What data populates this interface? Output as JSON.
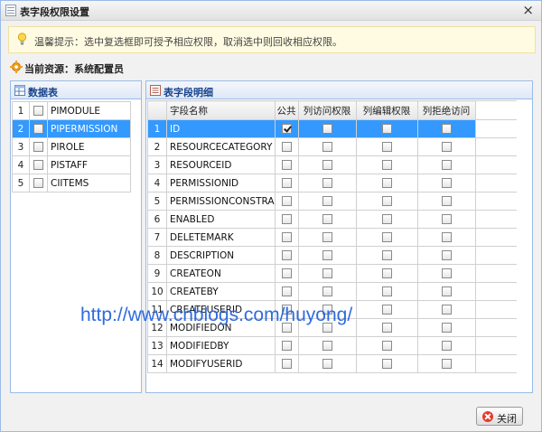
{
  "window": {
    "title": "表字段权限设置",
    "close_glyph": "×"
  },
  "tip": {
    "icon": "lightbulb-icon",
    "text": "温馨提示：选中复选框即可授予相应权限，取消选中则回收相应权限。"
  },
  "resource": {
    "icon": "gear-icon",
    "text": "当前资源：系统配置员"
  },
  "left_panel": {
    "title": "数据表",
    "icon": "table-icon",
    "rows": [
      {
        "num": "1",
        "name": "PIMODULE",
        "checked": false,
        "selected": false
      },
      {
        "num": "2",
        "name": "PIPERMISSION",
        "checked": false,
        "selected": true
      },
      {
        "num": "3",
        "name": "PIROLE",
        "checked": false,
        "selected": false
      },
      {
        "num": "4",
        "name": "PISTAFF",
        "checked": false,
        "selected": false
      },
      {
        "num": "5",
        "name": "CIITEMS",
        "checked": false,
        "selected": false
      }
    ]
  },
  "right_panel": {
    "title": "表字段明细",
    "icon": "list-icon",
    "columns": {
      "field_name": "字段名称",
      "public": "公共",
      "access": "列访问权限",
      "edit": "列编辑权限",
      "deny": "列拒绝访问"
    },
    "rows": [
      {
        "num": "1",
        "name": "ID",
        "public": true,
        "access": false,
        "edit": false,
        "deny": false,
        "selected": true
      },
      {
        "num": "2",
        "name": "RESOURCECATEGORY",
        "public": false,
        "access": false,
        "edit": false,
        "deny": false,
        "selected": false
      },
      {
        "num": "3",
        "name": "RESOURCEID",
        "public": false,
        "access": false,
        "edit": false,
        "deny": false,
        "selected": false
      },
      {
        "num": "4",
        "name": "PERMISSIONID",
        "public": false,
        "access": false,
        "edit": false,
        "deny": false,
        "selected": false
      },
      {
        "num": "5",
        "name": "PERMISSIONCONSTRA",
        "public": false,
        "access": false,
        "edit": false,
        "deny": false,
        "selected": false
      },
      {
        "num": "6",
        "name": "ENABLED",
        "public": false,
        "access": false,
        "edit": false,
        "deny": false,
        "selected": false
      },
      {
        "num": "7",
        "name": "DELETEMARK",
        "public": false,
        "access": false,
        "edit": false,
        "deny": false,
        "selected": false
      },
      {
        "num": "8",
        "name": "DESCRIPTION",
        "public": false,
        "access": false,
        "edit": false,
        "deny": false,
        "selected": false
      },
      {
        "num": "9",
        "name": "CREATEON",
        "public": false,
        "access": false,
        "edit": false,
        "deny": false,
        "selected": false
      },
      {
        "num": "10",
        "name": "CREATEBY",
        "public": false,
        "access": false,
        "edit": false,
        "deny": false,
        "selected": false
      },
      {
        "num": "11",
        "name": "CREATEUSERID",
        "public": false,
        "access": false,
        "edit": false,
        "deny": false,
        "selected": false
      },
      {
        "num": "12",
        "name": "MODIFIEDON",
        "public": false,
        "access": false,
        "edit": false,
        "deny": false,
        "selected": false
      },
      {
        "num": "13",
        "name": "MODIFIEDBY",
        "public": false,
        "access": false,
        "edit": false,
        "deny": false,
        "selected": false
      },
      {
        "num": "14",
        "name": "MODIFYUSERID",
        "public": false,
        "access": false,
        "edit": false,
        "deny": false,
        "selected": false
      }
    ]
  },
  "watermark": "http://www.cnblogs.com/huyong/",
  "footer": {
    "close_label": "关闭",
    "close_icon": "close-circle-icon"
  },
  "colors": {
    "selection": "#3399ff",
    "panel_border": "#99bbe8",
    "watermark": "#2d6be0"
  }
}
